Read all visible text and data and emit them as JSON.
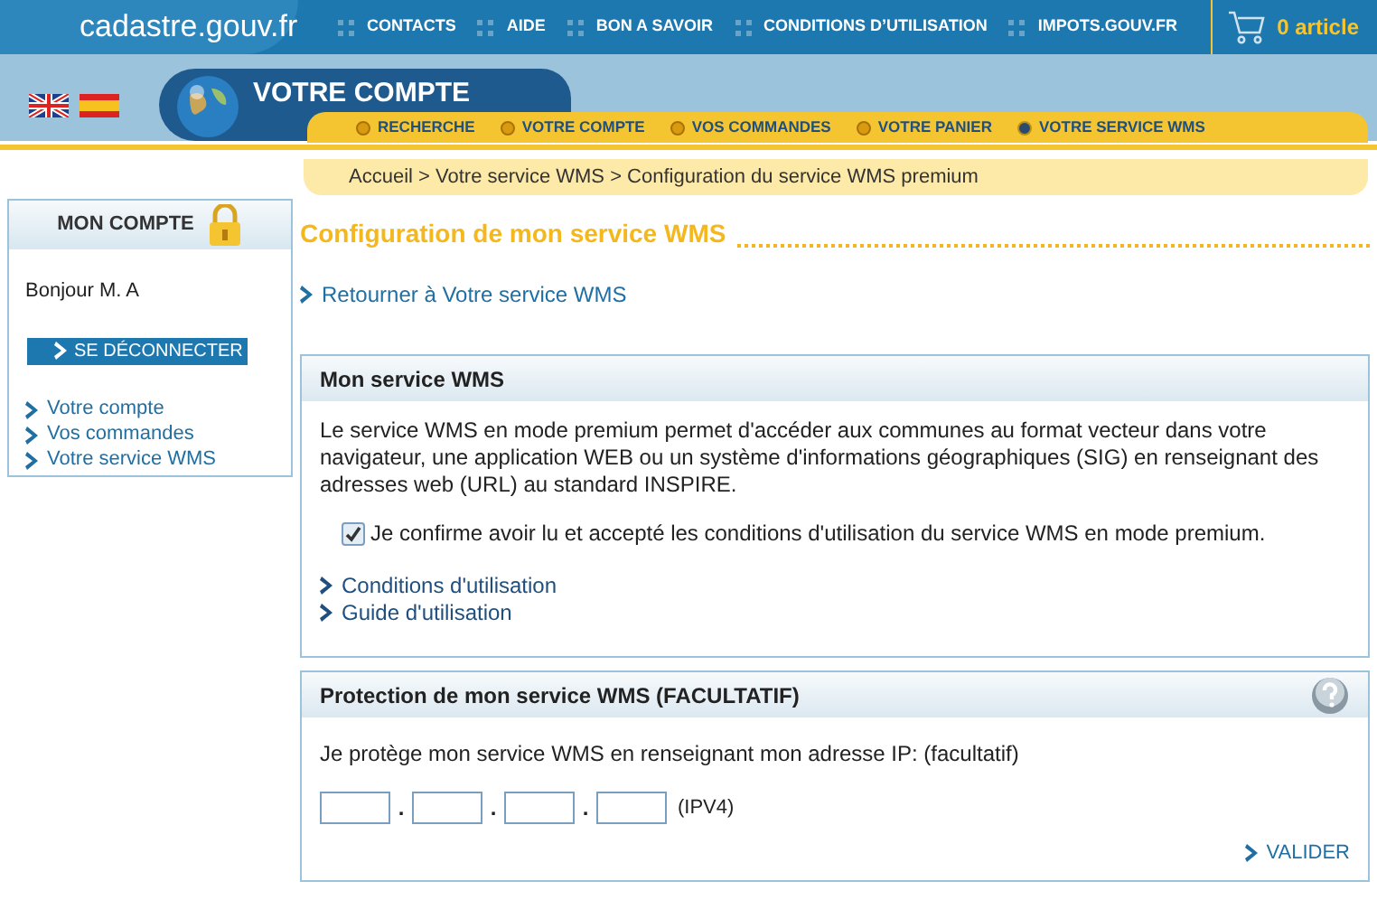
{
  "header": {
    "logo": "cadastre.gouv.fr",
    "links": [
      "CONTACTS",
      "AIDE",
      "BON A SAVOIR",
      "CONDITIONS D’UTILISATION",
      "IMPOTS.GOUV.FR"
    ],
    "cart": "0 article"
  },
  "section_title": "VOTRE COMPTE",
  "nav": [
    {
      "label": "RECHERCHE",
      "selected": false
    },
    {
      "label": "VOTRE COMPTE",
      "selected": false
    },
    {
      "label": "VOS COMMANDES",
      "selected": false
    },
    {
      "label": "VOTRE PANIER",
      "selected": false
    },
    {
      "label": "VOTRE SERVICE WMS",
      "selected": true
    }
  ],
  "breadcrumb": "Accueil > Votre service WMS > Configuration du service WMS premium",
  "sidebar": {
    "title": "MON COMPTE",
    "greeting": "Bonjour M. A",
    "logout": "SE DÉCONNECTER",
    "links": [
      "Votre compte",
      "Vos commandes",
      "Votre service WMS"
    ]
  },
  "page_title": "Configuration de mon service WMS",
  "back_link": "Retourner à Votre service WMS",
  "wms_panel": {
    "title": "Mon service WMS",
    "description": "Le service WMS en mode premium permet d'accéder aux communes au format vecteur dans votre navigateur, une application WEB ou un système d'informations géographiques (SIG) en renseignant des adresses web (URL) au standard INSPIRE.",
    "confirm": {
      "label": "Je confirme avoir lu et accepté les conditions d'utilisation du service WMS en mode premium.",
      "checked": true
    },
    "links": [
      "Conditions d'utilisation",
      "Guide d'utilisation"
    ]
  },
  "protection_panel": {
    "title": "Protection de mon service WMS (FACULTATIF)",
    "text": "Je protège mon service WMS en renseignant mon adresse IP: (facultatif)",
    "ip_separators": [
      ".",
      ".",
      "."
    ],
    "ip_suffix": "(IPV4)",
    "submit": "VALIDER"
  }
}
